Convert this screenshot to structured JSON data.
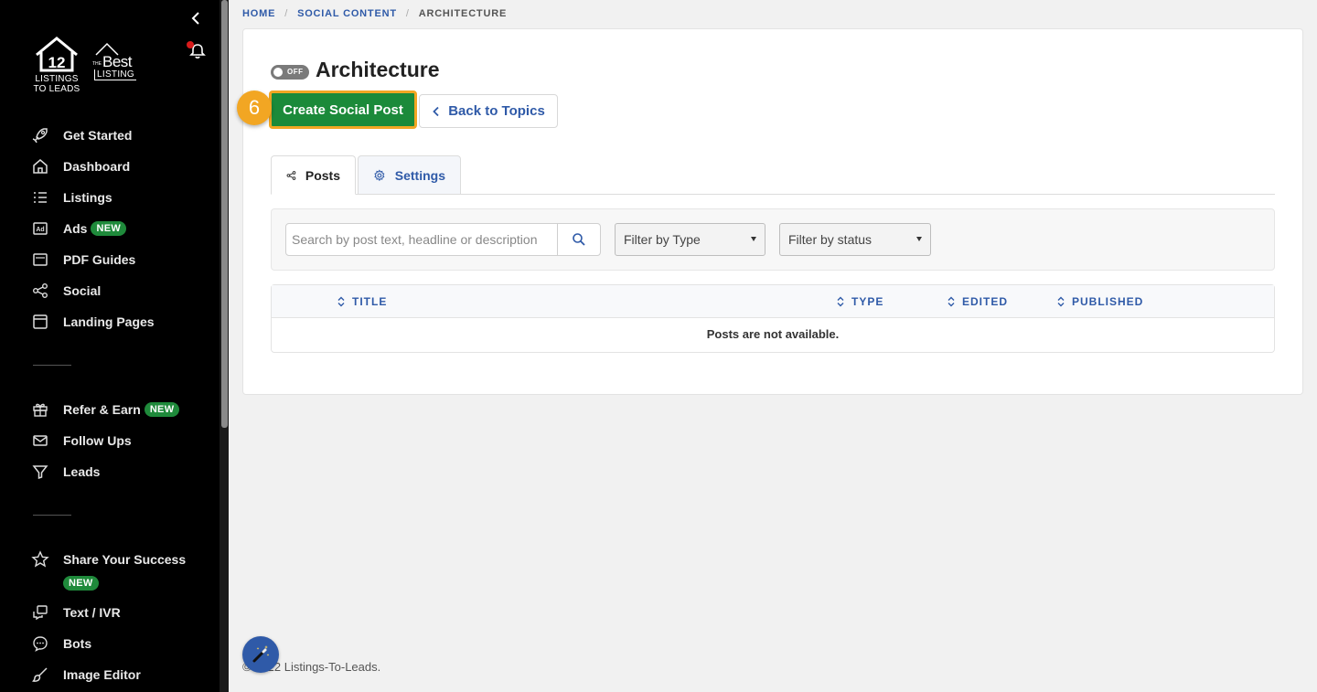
{
  "sidebar": {
    "logo_main_text": "LISTINGS TO LEADS",
    "logo_main_number": "12",
    "logo_best_the": "THE",
    "logo_best_best": "Best",
    "logo_best_listing": "LISTING",
    "items": [
      {
        "label": "Get Started",
        "icon": "rocket-icon"
      },
      {
        "label": "Dashboard",
        "icon": "home-icon"
      },
      {
        "label": "Listings",
        "icon": "list-icon"
      },
      {
        "label": "Ads",
        "icon": "ad-icon",
        "badge": "NEW"
      },
      {
        "label": "PDF Guides",
        "icon": "pdf-icon"
      },
      {
        "label": "Social",
        "icon": "share-icon"
      },
      {
        "label": "Landing Pages",
        "icon": "window-icon"
      },
      {
        "label": "Refer & Earn",
        "icon": "gift-icon",
        "badge": "NEW"
      },
      {
        "label": "Follow Ups",
        "icon": "envelope-icon"
      },
      {
        "label": "Leads",
        "icon": "filter-icon"
      },
      {
        "label": "Share Your Success",
        "icon": "star-icon",
        "badge": "NEW"
      },
      {
        "label": "Text / IVR",
        "icon": "chat-icon"
      },
      {
        "label": "Bots",
        "icon": "bot-icon"
      },
      {
        "label": "Image Editor",
        "icon": "brush-icon"
      }
    ]
  },
  "breadcrumb": {
    "items": [
      "HOME",
      "SOCIAL CONTENT",
      "ARCHITECTURE"
    ],
    "separator": "/"
  },
  "header": {
    "toggle_label": "OFF",
    "title": "Architecture"
  },
  "actions": {
    "step_number": "6",
    "create_label": "Create Social Post",
    "back_label": "Back to Topics"
  },
  "tabs": [
    {
      "label": "Posts",
      "icon": "share-icon",
      "active": true
    },
    {
      "label": "Settings",
      "icon": "gear-icon",
      "active": false
    }
  ],
  "filters": {
    "search_placeholder": "Search by post text, headline or description",
    "type_selected": "Filter by Type",
    "status_selected": "Filter by status"
  },
  "table": {
    "columns": [
      "TITLE",
      "TYPE",
      "EDITED",
      "PUBLISHED"
    ],
    "empty_message": "Posts are not available."
  },
  "footer": {
    "text": "© 2022 Listings-To-Leads."
  },
  "colors": {
    "sidebar_bg": "#000000",
    "accent_blue": "#2f5aa8",
    "create_green": "#1b8a3a",
    "highlight_orange": "#f2a623",
    "badge_green": "#1f8a3b"
  }
}
